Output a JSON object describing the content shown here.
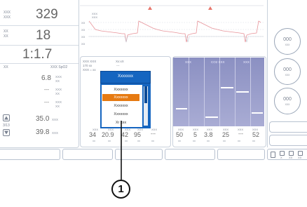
{
  "left": {
    "row1": {
      "label_top": "XXX",
      "label_bottom": "XXX",
      "value": "329"
    },
    "row2": {
      "label_top": "XX",
      "label_bottom": "XX",
      "value": "18"
    },
    "row3": {
      "value": "1:1.7"
    },
    "row4": {
      "label_left": "XX",
      "label_right": "XXX SpO2"
    },
    "meas": [
      {
        "value": "6.8",
        "unit_top": "XXX",
        "unit_bottom": "XX"
      },
      {
        "value": "---",
        "unit_top": "XXX",
        "unit_bottom": "XX"
      },
      {
        "value": "---",
        "unit_top": "XXX",
        "unit_bottom": "XX"
      }
    ],
    "pager": "3/13",
    "bottom_values": [
      {
        "value": "35.0",
        "unit": "XXX"
      },
      {
        "value": "39.8",
        "unit": "XXX"
      }
    ]
  },
  "waveform": {
    "scale_labels": [
      "XXX",
      "XXX",
      "XX",
      "XX",
      "XX",
      "XX"
    ]
  },
  "config": {
    "header_lines": [
      "XXX XXX",
      "170 xx",
      "XXX = xx"
    ],
    "header_right": [
      "Xx:xX",
      "---"
    ],
    "bottom_labels": [
      "XXX",
      "XXX",
      "XXX",
      "XXX",
      "XXX"
    ],
    "bottom_values": [
      "34",
      "20.9",
      "42",
      "95",
      "---"
    ],
    "bottom_units": [
      "xx",
      "xx",
      "xx",
      "xx",
      "xx"
    ]
  },
  "dropdown": {
    "selected_value": "Xxxxxxx",
    "options": [
      "Xxxxxxx",
      "Xxxxxxx",
      "Xxxxxxx",
      "Xxxxxxx",
      "Xr xxx"
    ],
    "selected_index": 1
  },
  "bars": {
    "headers": [
      "XXX",
      "CO2 XXX",
      "XXX"
    ],
    "labels": [
      "XXX",
      "XXX",
      "XXX",
      "XXX",
      "XXX",
      "XXX"
    ],
    "values": [
      "50",
      "5",
      "3.8",
      "25",
      "---",
      "52"
    ],
    "units": [
      "xx",
      "xx",
      "xx",
      "xx",
      "xx",
      "xx"
    ]
  },
  "right_buttons": [
    {
      "value": "000",
      "sub": "xxx"
    },
    {
      "value": "000",
      "sub": "xxx"
    },
    {
      "value": "000",
      "sub": "xxx"
    }
  ],
  "bottom_icons": [
    "X",
    "XX",
    "XX"
  ],
  "callout": {
    "number": "1"
  }
}
